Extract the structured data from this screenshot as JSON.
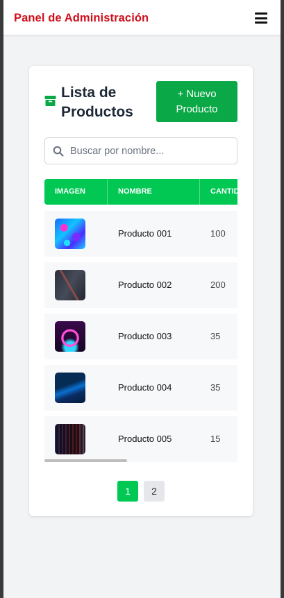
{
  "navbar": {
    "brand": "Panel de Administración",
    "menu_icon": "hamburger-menu-icon"
  },
  "card": {
    "title_icon": "box-icon",
    "title": "Lista de Productos",
    "new_button_label": "+ Nuevo Producto"
  },
  "search": {
    "icon": "search-icon",
    "placeholder": "Buscar por nombre..."
  },
  "table": {
    "headers": [
      "IMAGEN",
      "NOMBRE",
      "CANTIDAD"
    ],
    "rows": [
      {
        "name": "Producto 001",
        "quantity": "100"
      },
      {
        "name": "Producto 002",
        "quantity": "200"
      },
      {
        "name": "Producto 003",
        "quantity": "35"
      },
      {
        "name": "Producto 004",
        "quantity": "35"
      },
      {
        "name": "Producto 005",
        "quantity": "15"
      }
    ]
  },
  "pagination": {
    "pages": [
      "1",
      "2"
    ],
    "current": "1"
  },
  "colors": {
    "brand": "#d0101b",
    "primary_button": "#0aa846",
    "table_header": "#00c853"
  }
}
